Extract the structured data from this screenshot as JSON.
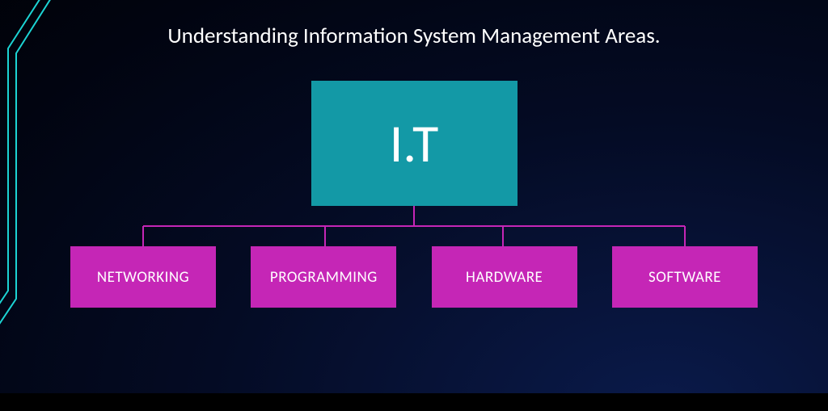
{
  "title": "Understanding Information System Management Areas.",
  "root": {
    "label": "I.T"
  },
  "children": [
    {
      "label": "NETWORKING"
    },
    {
      "label": "PROGRAMMING"
    },
    {
      "label": "HARDWARE"
    },
    {
      "label": "SOFTWARE"
    }
  ],
  "colors": {
    "root_box": "#1399a6",
    "child_box": "#c526b6",
    "connector": "#c526b6",
    "accent_line": "#1cd4d4"
  }
}
